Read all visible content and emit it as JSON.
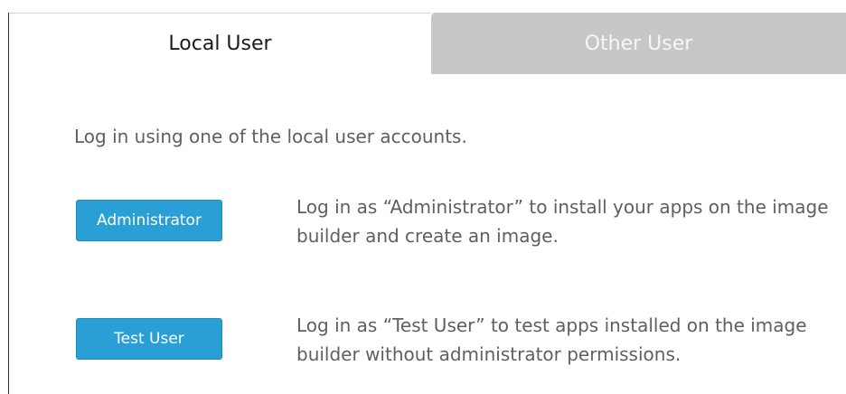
{
  "tabs": {
    "local_label": "Local User",
    "other_label": "Other User"
  },
  "intro": "Log in using one of the local user accounts.",
  "accounts": [
    {
      "button_label": "Administrator",
      "description": "Log in as “Administrator” to install your apps on the image builder and create an image."
    },
    {
      "button_label": "Test User",
      "description": "Log in as “Test User” to test apps installed on the image builder without administrator permissions."
    }
  ],
  "colors": {
    "button_blue": "#2a9fd6",
    "inactive_tab_gray": "#c7c7c7",
    "body_text": "#5f5f5f"
  }
}
